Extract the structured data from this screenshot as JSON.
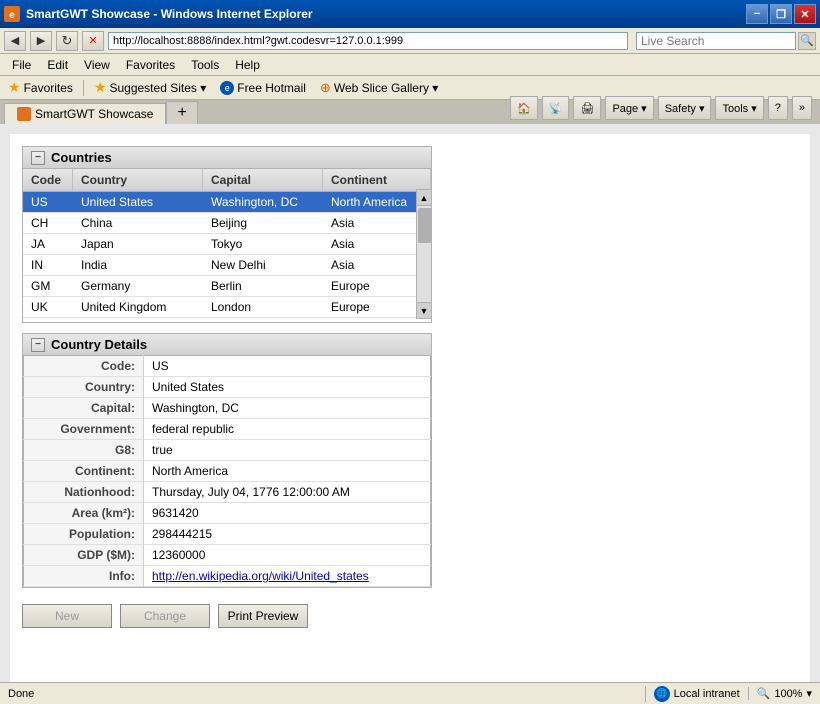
{
  "window": {
    "title": "SmartGWT Showcase - Windows Internet Explorer",
    "url": "http://localhost:8888/index.html?gwt.codesvr=127.0.0.1:999"
  },
  "titlebar": {
    "title": "SmartGWT Showcase - Windows Internet Explorer",
    "minimize": "−",
    "restore": "❐",
    "close": "✕"
  },
  "navbar": {
    "back": "◀",
    "forward": "▶",
    "refresh": "↻",
    "stop": "✕",
    "url": "http://localhost:8888/index.html?gwt.codesvr=127.0.0.1:999",
    "search_placeholder": "Live Search",
    "go": "Go"
  },
  "menubar": {
    "items": [
      "File",
      "Edit",
      "View",
      "Favorites",
      "Tools",
      "Help"
    ]
  },
  "favbar": {
    "favorites_label": "Favorites",
    "suggested_label": "Suggested Sites ▾",
    "hotmail_label": "Free Hotmail",
    "webslice_label": "Web Slice Gallery ▾"
  },
  "tab": {
    "label": "SmartGWT Showcase",
    "new_tab": ""
  },
  "toolbar": {
    "page": "Page ▾",
    "safety": "Safety ▾",
    "tools": "Tools ▾",
    "help": "?"
  },
  "search": {
    "placeholder": "Search",
    "value": ""
  },
  "countries": {
    "section_title": "Countries",
    "columns": [
      "Code",
      "Country",
      "Capital",
      "Continent"
    ],
    "rows": [
      {
        "code": "US",
        "country": "United States",
        "capital": "Washington, DC",
        "continent": "North America",
        "selected": true
      },
      {
        "code": "CH",
        "country": "China",
        "capital": "Beijing",
        "continent": "Asia"
      },
      {
        "code": "JA",
        "country": "Japan",
        "capital": "Tokyo",
        "continent": "Asia"
      },
      {
        "code": "IN",
        "country": "India",
        "capital": "New Delhi",
        "continent": "Asia"
      },
      {
        "code": "GM",
        "country": "Germany",
        "capital": "Berlin",
        "continent": "Europe"
      },
      {
        "code": "UK",
        "country": "United Kingdom",
        "capital": "London",
        "continent": "Europe"
      }
    ]
  },
  "details": {
    "section_title": "Country Details",
    "fields": [
      {
        "label": "Code:",
        "value": "US"
      },
      {
        "label": "Country:",
        "value": "United States"
      },
      {
        "label": "Capital:",
        "value": "Washington, DC"
      },
      {
        "label": "Government:",
        "value": "federal republic"
      },
      {
        "label": "G8:",
        "value": "true"
      },
      {
        "label": "Continent:",
        "value": "North America"
      },
      {
        "label": "Nationhood:",
        "value": "Thursday, July 04, 1776 12:00:00 AM"
      },
      {
        "label": "Area (km²):",
        "value": "9631420"
      },
      {
        "label": "Population:",
        "value": "298444215"
      },
      {
        "label": "GDP ($M):",
        "value": "12360000"
      },
      {
        "label": "Info:",
        "value": "http://en.wikipedia.org/wiki/United_states",
        "is_link": true
      }
    ]
  },
  "buttons": {
    "new_label": "New",
    "change_label": "Change",
    "print_preview_label": "Print Preview"
  },
  "statusbar": {
    "status": "Done",
    "zone": "Local intranet",
    "zoom": "100%"
  }
}
